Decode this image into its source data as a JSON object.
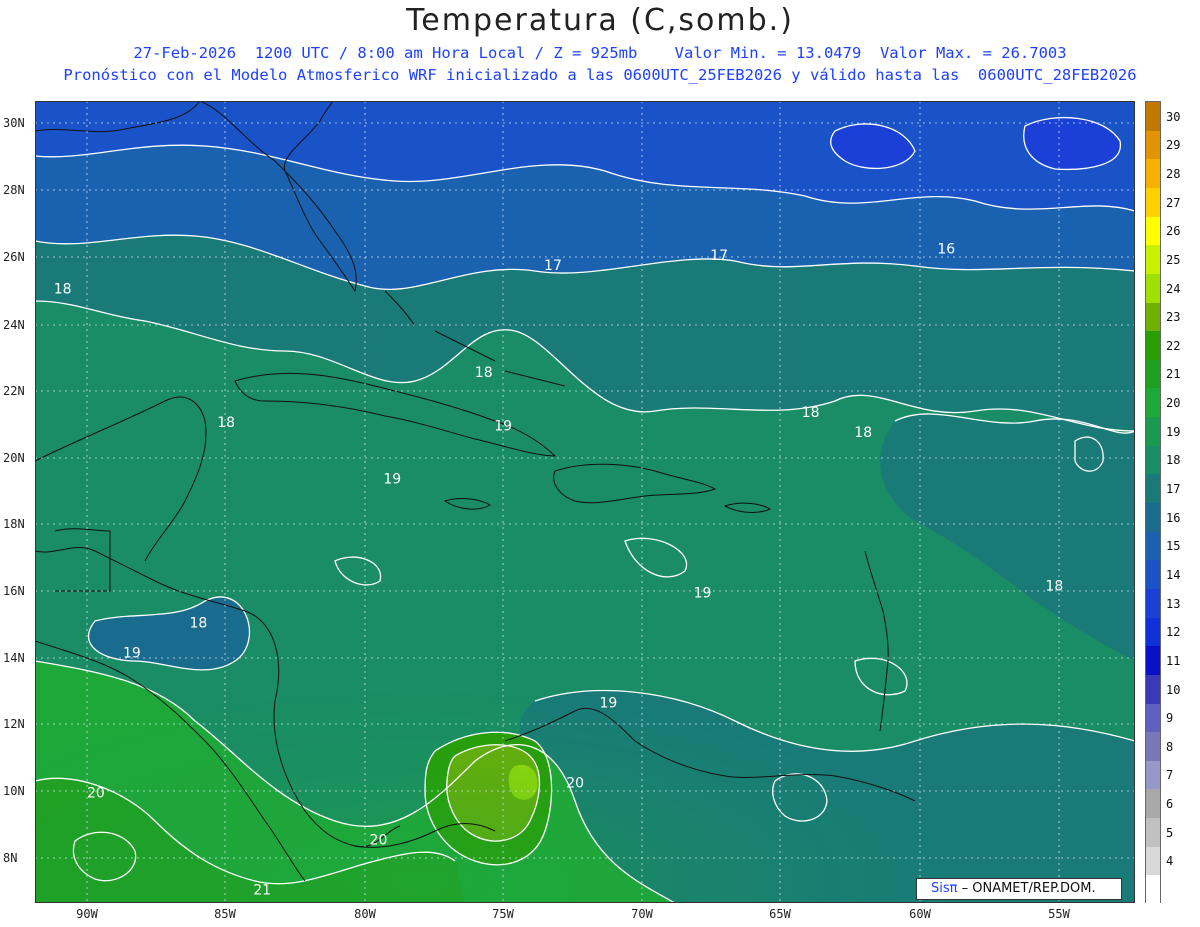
{
  "header": {
    "title": "Temperatura (C,somb.)",
    "line1": "27-Feb-2026  1200 UTC / 8:00 am Hora Local / Z = 925mb    Valor Min. = 13.0479  Valor Max. = 26.7003",
    "line2": "Pronóstico con el Modelo Atmosferico WRF inicializado a las 0600UTC_25FEB2026 y válido hasta las  0600UTC_28FEB2026"
  },
  "map": {
    "lat_labels": [
      "30N",
      "28N",
      "26N",
      "24N",
      "22N",
      "20N",
      "18N",
      "16N",
      "14N",
      "12N",
      "10N",
      "8N"
    ],
    "lon_labels": [
      "90W",
      "85W",
      "80W",
      "75W",
      "70W",
      "65W",
      "60W",
      "55W"
    ],
    "contour_labels": [
      {
        "text": "18",
        "lon": -91.2,
        "lat": 24.9
      },
      {
        "text": "17",
        "lon": -73.5,
        "lat": 25.6
      },
      {
        "text": "17",
        "lon": -67.5,
        "lat": 25.9
      },
      {
        "text": "16",
        "lon": -59.3,
        "lat": 26.1
      },
      {
        "text": "18",
        "lon": -76.0,
        "lat": 22.4
      },
      {
        "text": "18",
        "lon": -85.3,
        "lat": 20.9
      },
      {
        "text": "19",
        "lon": -75.3,
        "lat": 20.8
      },
      {
        "text": "18",
        "lon": -64.2,
        "lat": 21.2
      },
      {
        "text": "18",
        "lon": -62.3,
        "lat": 20.6
      },
      {
        "text": "19",
        "lon": -79.3,
        "lat": 19.2
      },
      {
        "text": "19",
        "lon": -68.1,
        "lat": 15.8
      },
      {
        "text": "18",
        "lon": -55.4,
        "lat": 16.0
      },
      {
        "text": "18",
        "lon": -86.3,
        "lat": 14.9
      },
      {
        "text": "19",
        "lon": -88.7,
        "lat": 14.0
      },
      {
        "text": "19",
        "lon": -71.5,
        "lat": 12.5
      },
      {
        "text": "20",
        "lon": -90.0,
        "lat": 9.8
      },
      {
        "text": "20",
        "lon": -72.7,
        "lat": 10.1
      },
      {
        "text": "20",
        "lon": -79.8,
        "lat": 8.4
      },
      {
        "text": "21",
        "lon": -84.0,
        "lat": 6.9
      }
    ]
  },
  "legend": {
    "labels": [
      "30",
      "29",
      "28",
      "27",
      "26",
      "25",
      "24",
      "23",
      "22",
      "21",
      "20",
      "19",
      "18",
      "17",
      "16",
      "15",
      "14",
      "13",
      "12",
      "11",
      "10",
      "9",
      "8",
      "7",
      "6",
      "5",
      "4"
    ],
    "colors": [
      "#c07800",
      "#e09400",
      "#f5b000",
      "#ffd000",
      "#ffff00",
      "#c8f000",
      "#a0e000",
      "#70b000",
      "#2a9e00",
      "#20a020",
      "#1ea838",
      "#1a9a50",
      "#1a8c66",
      "#197a78",
      "#1a6c8e",
      "#1a62b0",
      "#1a52c8",
      "#1a40d8",
      "#1030d8",
      "#0a10c8",
      "#3a3ab8",
      "#6060c0",
      "#7878b8",
      "#9898c8",
      "#a8a8a8",
      "#c0c0c0",
      "#d8d8d8",
      "#ffffff"
    ]
  },
  "credit": {
    "brand": "Sisπ",
    "text": "– ONAMET/REP.DOM."
  }
}
